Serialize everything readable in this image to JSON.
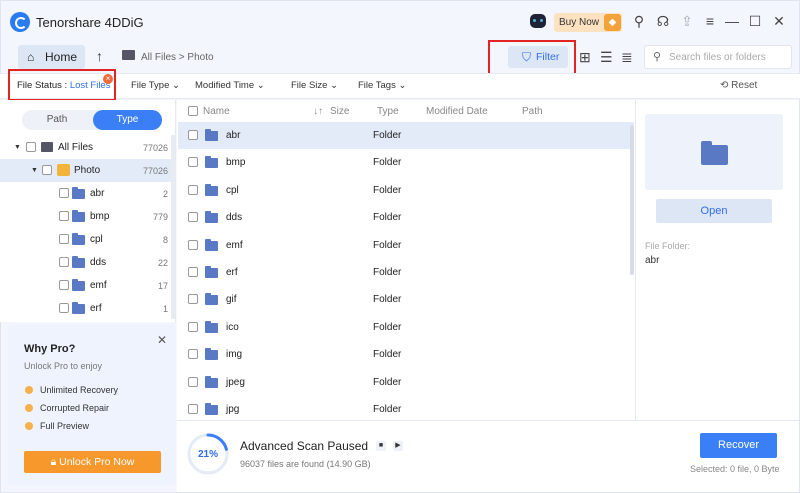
{
  "app": {
    "title": "Tenorshare 4DDiG",
    "buy_label": "Buy Now"
  },
  "nav": {
    "home_label": "Home",
    "breadcrumb": "All Files  >  Photo",
    "filter_label": "Filter",
    "search_placeholder": "Search files or folders"
  },
  "filters": {
    "status_label": "File Status :",
    "status_value": "Lost Files",
    "file_type": "File Type",
    "modified_time": "Modified Time",
    "file_size": "File Size",
    "file_tags": "File Tags",
    "reset": "Reset"
  },
  "sidebar": {
    "tab_path": "Path",
    "tab_type": "Type",
    "tree": [
      {
        "label": "All Files",
        "count": "77026"
      },
      {
        "label": "Photo",
        "count": "77026"
      },
      {
        "label": "abr",
        "count": "2"
      },
      {
        "label": "bmp",
        "count": "779"
      },
      {
        "label": "cpl",
        "count": "8"
      },
      {
        "label": "dds",
        "count": "22"
      },
      {
        "label": "emf",
        "count": "17"
      },
      {
        "label": "erf",
        "count": "1"
      }
    ]
  },
  "promo": {
    "title": "Why Pro?",
    "subtitle": "Unlock Pro to enjoy",
    "items": [
      "Unlimited Recovery",
      "Corrupted Repair",
      "Full Preview"
    ],
    "button": "Unlock Pro Now"
  },
  "table": {
    "columns": [
      "Name",
      "Size",
      "Type",
      "Modified Date",
      "Path"
    ],
    "rows": [
      {
        "name": "abr",
        "type": "Folder"
      },
      {
        "name": "bmp",
        "type": "Folder"
      },
      {
        "name": "cpl",
        "type": "Folder"
      },
      {
        "name": "dds",
        "type": "Folder"
      },
      {
        "name": "emf",
        "type": "Folder"
      },
      {
        "name": "erf",
        "type": "Folder"
      },
      {
        "name": "gif",
        "type": "Folder"
      },
      {
        "name": "ico",
        "type": "Folder"
      },
      {
        "name": "img",
        "type": "Folder"
      },
      {
        "name": "jpeg",
        "type": "Folder"
      },
      {
        "name": "jpg",
        "type": "Folder"
      }
    ]
  },
  "preview": {
    "open_label": "Open",
    "meta_label": "File Folder:",
    "meta_value": "abr"
  },
  "scan": {
    "progress": "21%",
    "progress_value": 0.21,
    "title": "Advanced Scan Paused",
    "subtitle": "96037 files are found (14.90 GB)",
    "recover_label": "Recover",
    "selected": "Selected: 0 file, 0 Byte"
  },
  "colors": {
    "accent": "#3a7ff5",
    "promo_button": "#f6982b",
    "highlight_box": "#e32424"
  }
}
